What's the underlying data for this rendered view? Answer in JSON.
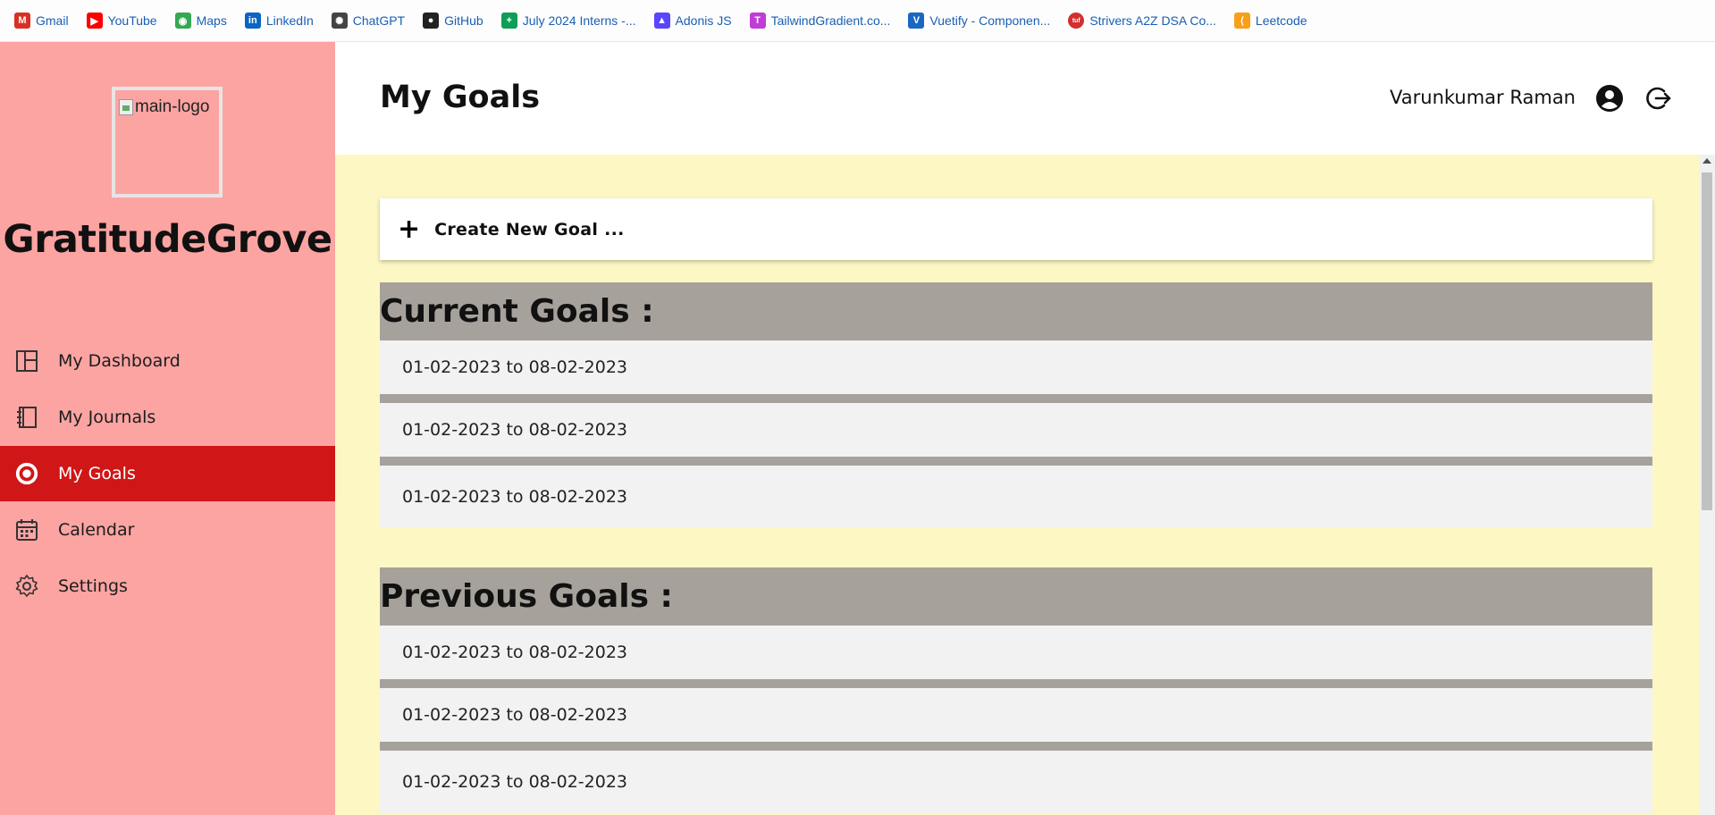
{
  "bookmarks": [
    {
      "label": "Gmail",
      "icon": "gmail-icon",
      "color": "#d93025",
      "glyph": "M"
    },
    {
      "label": "YouTube",
      "icon": "youtube-icon",
      "color": "#ff0000",
      "glyph": "▶"
    },
    {
      "label": "Maps",
      "icon": "maps-icon",
      "color": "#34a853",
      "glyph": "◉"
    },
    {
      "label": "LinkedIn",
      "icon": "linkedin-icon",
      "color": "#0a66c2",
      "glyph": "in"
    },
    {
      "label": "ChatGPT",
      "icon": "chatgpt-icon",
      "color": "#444444",
      "glyph": "✺"
    },
    {
      "label": "GitHub",
      "icon": "github-icon",
      "color": "#222222",
      "glyph": "●"
    },
    {
      "label": "July 2024 Interns -...",
      "icon": "sheets-icon",
      "color": "#0f9d58",
      "glyph": "+"
    },
    {
      "label": "Adonis JS",
      "icon": "adonis-icon",
      "color": "#5a45ff",
      "glyph": "▲"
    },
    {
      "label": "TailwindGradient.co...",
      "icon": "tailwindgradient-icon",
      "color": "#c13bd6",
      "glyph": "T"
    },
    {
      "label": "Vuetify - Componen...",
      "icon": "vuetify-icon",
      "color": "#1867c0",
      "glyph": "V"
    },
    {
      "label": "Strivers A2Z DSA Co...",
      "icon": "tuf-icon",
      "color": "#d32f2f",
      "glyph": "tuf"
    },
    {
      "label": "Leetcode",
      "icon": "leetcode-icon",
      "color": "#f89f1b",
      "glyph": "⟨"
    }
  ],
  "sidebar": {
    "logo_alt": "main-logo",
    "app_name": "GratitudeGrove",
    "items": [
      {
        "label": "My Dashboard",
        "icon": "dashboard-icon",
        "active": false
      },
      {
        "label": "My Journals",
        "icon": "journal-icon",
        "active": false
      },
      {
        "label": "My Goals",
        "icon": "target-icon",
        "active": true
      },
      {
        "label": "Calendar",
        "icon": "calendar-icon",
        "active": false
      },
      {
        "label": "Settings",
        "icon": "settings-icon",
        "active": false
      }
    ]
  },
  "header": {
    "title": "My Goals",
    "user_name": "Varunkumar Raman"
  },
  "main": {
    "create_label": "Create New Goal ...",
    "current": {
      "heading": "Current Goals :",
      "goals": [
        "01-02-2023 to 08-02-2023",
        "01-02-2023 to 08-02-2023",
        "01-02-2023 to 08-02-2023"
      ]
    },
    "previous": {
      "heading": "Previous Goals :",
      "goals": [
        "01-02-2023 to 08-02-2023",
        "01-02-2023 to 08-02-2023",
        "01-02-2023 to 08-02-2023"
      ]
    }
  },
  "colors": {
    "sidebar_bg": "#fba4a2",
    "active_item": "#d01616",
    "main_bg": "#fdf7c4",
    "section_head": "#a7a19c",
    "goal_row": "#f2f2f2"
  }
}
